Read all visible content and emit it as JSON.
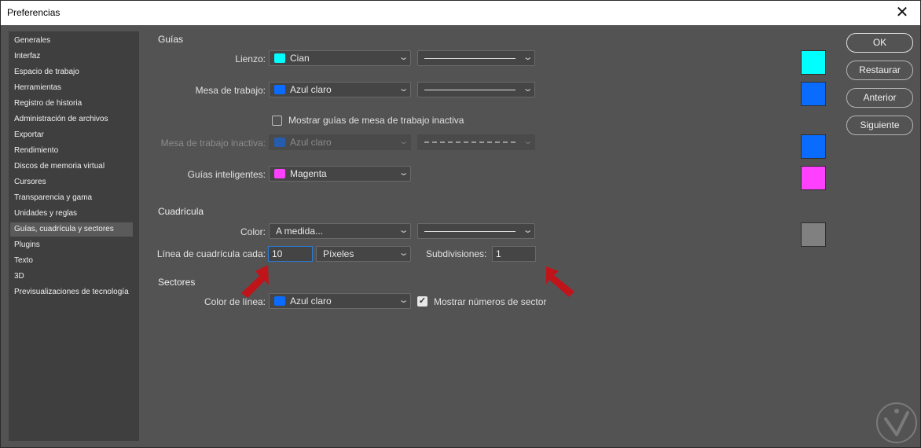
{
  "window": {
    "title": "Preferencias",
    "close_glyph": "✕"
  },
  "sidebar": {
    "items": [
      {
        "label": "Generales"
      },
      {
        "label": "Interfaz"
      },
      {
        "label": "Espacio de trabajo"
      },
      {
        "label": "Herramientas"
      },
      {
        "label": "Registro de historia"
      },
      {
        "label": "Administración de archivos"
      },
      {
        "label": "Exportar"
      },
      {
        "label": "Rendimiento"
      },
      {
        "label": "Discos de memoria virtual"
      },
      {
        "label": "Cursores"
      },
      {
        "label": "Transparencia y gama"
      },
      {
        "label": "Unidades y reglas"
      },
      {
        "label": "Guías, cuadrícula y sectores",
        "selected": true
      },
      {
        "label": "Plugins"
      },
      {
        "label": "Texto"
      },
      {
        "label": "3D"
      },
      {
        "label": "Previsualizaciones de tecnología"
      }
    ]
  },
  "guias": {
    "section_label": "Guías",
    "lienzo": {
      "label": "Lienzo:",
      "color_label": "Cian",
      "color": "#00ffff",
      "style": "solid"
    },
    "mesa": {
      "label": "Mesa de trabajo:",
      "color_label": "Azul claro",
      "color": "#0a6cff",
      "style": "solid"
    },
    "mostrar_inactiva": {
      "label": "Mostrar guías de mesa de trabajo inactiva",
      "checked": false
    },
    "mesa_inactiva": {
      "label": "Mesa de trabajo inactiva:",
      "color_label": "Azul claro",
      "color": "#0a6cff",
      "style": "dashed"
    },
    "inteligentes": {
      "label": "Guías inteligentes:",
      "color_label": "Magenta",
      "color": "#ff40ff"
    }
  },
  "cuadricula": {
    "section_label": "Cuadrícula",
    "color": {
      "label": "Color:",
      "value": "A medida...",
      "swatch": "#808080",
      "style": "solid"
    },
    "linea_cada": {
      "label": "Línea de cuadrícula cada:",
      "value": "10",
      "unit": "Píxeles"
    },
    "subdivisiones": {
      "label": "Subdivisiones:",
      "value": "1"
    }
  },
  "sectores": {
    "section_label": "Sectores",
    "color_linea": {
      "label": "Color de línea:",
      "color_label": "Azul claro",
      "color": "#0a6cff"
    },
    "mostrar_numeros": {
      "label": "Mostrar números de sector",
      "checked": true
    }
  },
  "buttons": {
    "ok": "OK",
    "restaurar": "Restaurar",
    "anterior": "Anterior",
    "siguiente": "Siguiente"
  },
  "colors": {
    "cian": "#00ffff",
    "azul_claro": "#0a6cff",
    "magenta": "#ff40ff",
    "gris": "#808080",
    "arrow": "#c0141b"
  }
}
